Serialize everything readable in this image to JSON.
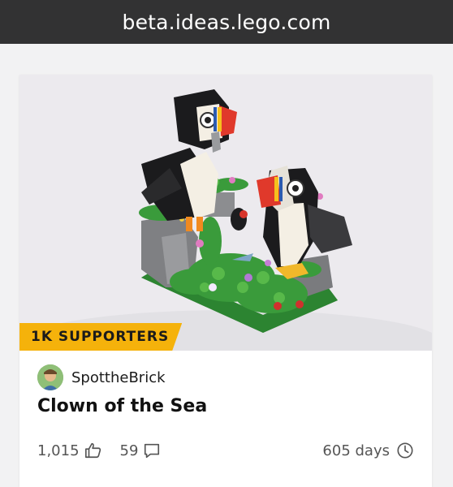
{
  "browser": {
    "url": "beta.ideas.lego.com"
  },
  "card": {
    "badge": "1K SUPPORTERS",
    "author": "SpottheBrick",
    "title": "Clown of the Sea",
    "supports": "1,015",
    "comments": "59",
    "days_left": "605 days"
  },
  "colors": {
    "badge": "#f5b20b",
    "topbar": "#323233",
    "text": "#111111",
    "muted": "#555555"
  },
  "icons": [
    "thumbs-up-icon",
    "comment-icon",
    "clock-icon"
  ]
}
